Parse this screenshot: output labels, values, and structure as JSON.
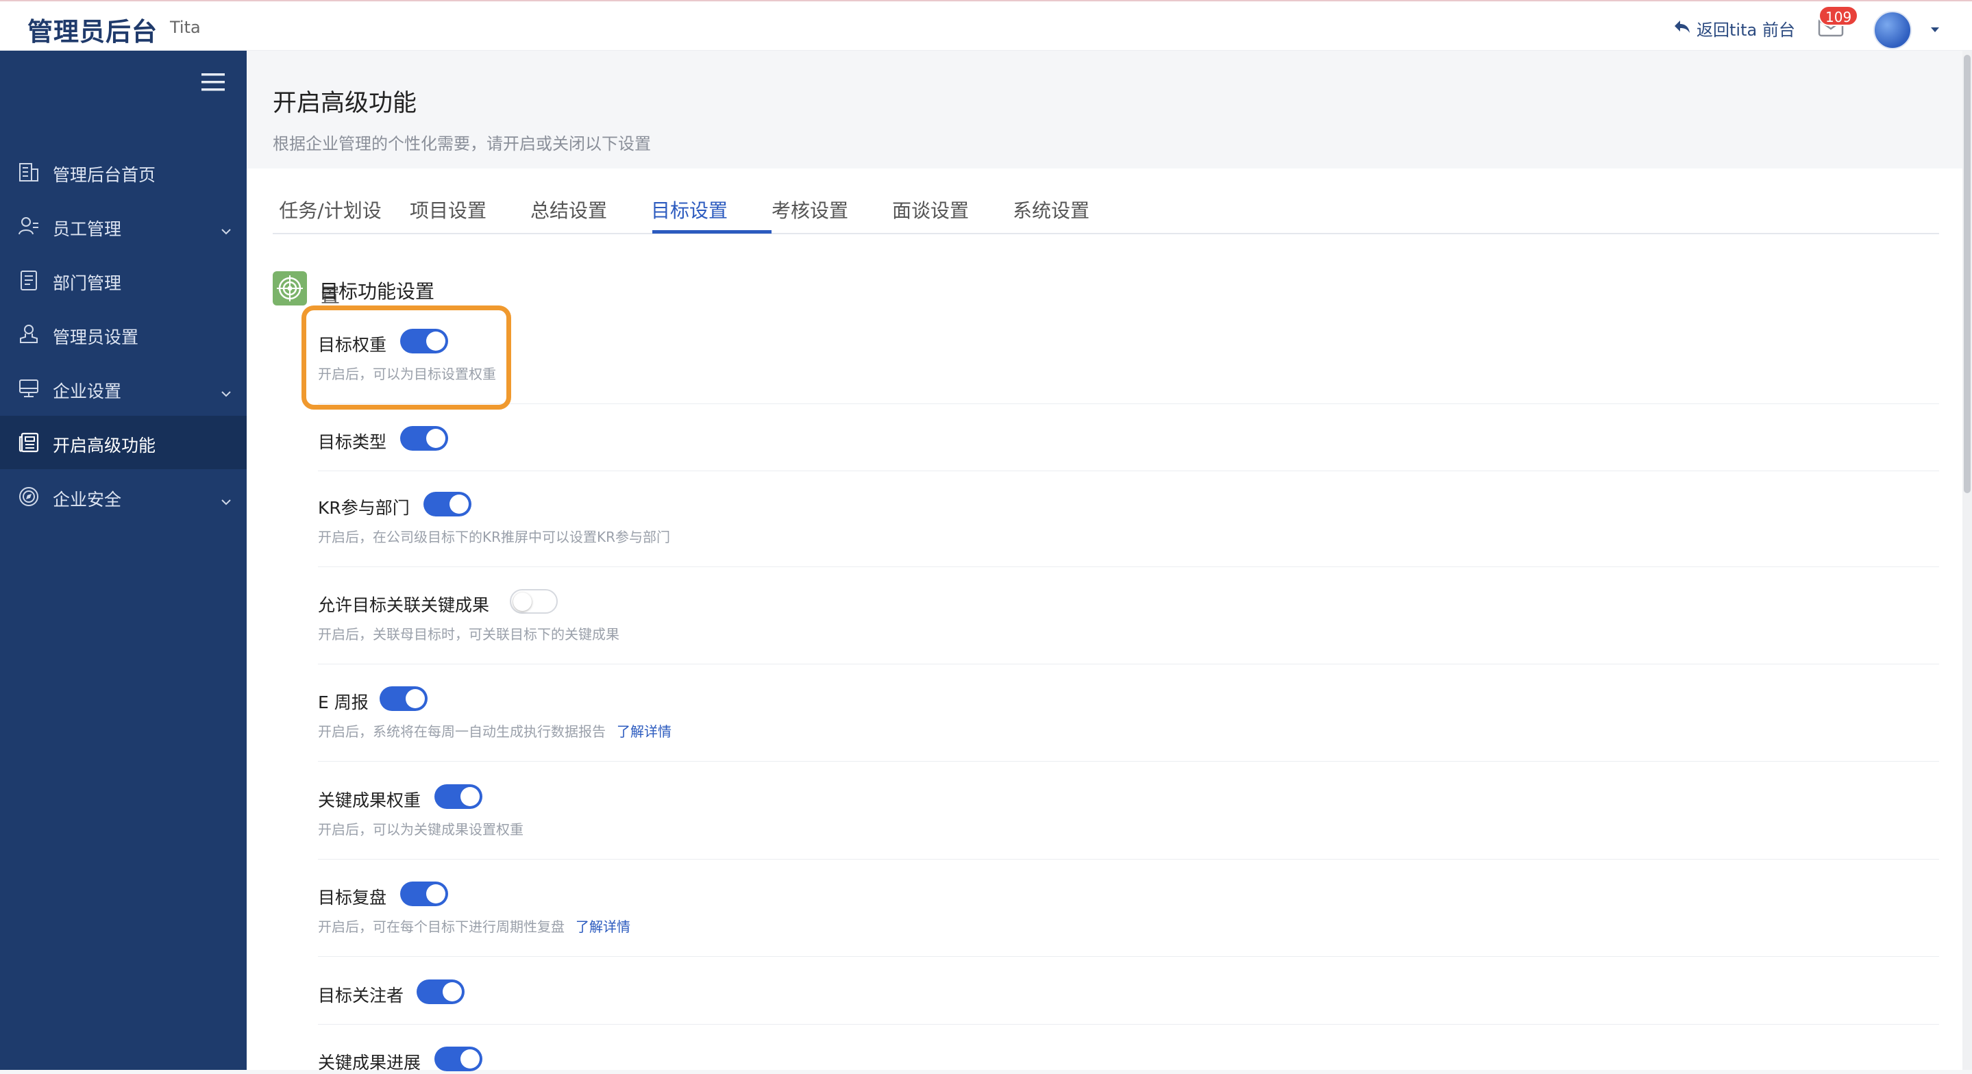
{
  "header": {
    "app_title": "管理员后台",
    "app_subtitle": "Tita",
    "back_link": "返回tita 前台",
    "notification_count": "109",
    "accent_color": "#2c5bbf",
    "badge_color": "#e8413a"
  },
  "sidebar": {
    "background": "#1e3b6c",
    "items": [
      {
        "label": "管理后台首页",
        "icon": "building-icon",
        "expandable": false,
        "active": false
      },
      {
        "label": "员工管理",
        "icon": "users-icon",
        "expandable": true,
        "active": false
      },
      {
        "label": "部门管理",
        "icon": "document-icon",
        "expandable": false,
        "active": false
      },
      {
        "label": "管理员设置",
        "icon": "admin-stamp-icon",
        "expandable": false,
        "active": false
      },
      {
        "label": "企业设置",
        "icon": "monitor-icon",
        "expandable": true,
        "active": false
      },
      {
        "label": "开启高级功能",
        "icon": "newspaper-icon",
        "expandable": false,
        "active": true
      },
      {
        "label": "企业安全",
        "icon": "compass-icon",
        "expandable": true,
        "active": false
      }
    ]
  },
  "page": {
    "title": "开启高级功能",
    "description": "根据企业管理的个性化需要，请开启或关闭以下设置"
  },
  "tabs": [
    {
      "label": "任务/计划设置",
      "active": false
    },
    {
      "label": "项目设置",
      "active": false
    },
    {
      "label": "总结设置",
      "active": false
    },
    {
      "label": "目标设置",
      "active": true
    },
    {
      "label": "考核设置",
      "active": false
    },
    {
      "label": "面谈设置",
      "active": false
    },
    {
      "label": "系统设置",
      "active": false
    }
  ],
  "section": {
    "title": "目标功能设置",
    "icon": "target-icon"
  },
  "settings": [
    {
      "name": "目标权重",
      "enabled": true,
      "description": "开启后，可以为目标设置权重",
      "link": ""
    },
    {
      "name": "目标类型",
      "enabled": true,
      "description": "",
      "link": ""
    },
    {
      "name": "KR参与部门",
      "enabled": true,
      "description": "开启后，在公司级目标下的KR推屏中可以设置KR参与部门",
      "link": ""
    },
    {
      "name": "允许目标关联关键成果",
      "enabled": false,
      "description": "开启后，关联母目标时，可关联目标下的关键成果",
      "link": ""
    },
    {
      "name": "E 周报",
      "enabled": true,
      "description": "开启后，系统将在每周一自动生成执行数据报告",
      "link": "了解详情"
    },
    {
      "name": "关键成果权重",
      "enabled": true,
      "description": "开启后，可以为关键成果设置权重",
      "link": ""
    },
    {
      "name": "目标复盘",
      "enabled": true,
      "description": "开启后，可在每个目标下进行周期性复盘",
      "link": "了解详情"
    },
    {
      "name": "目标关注者",
      "enabled": true,
      "description": "",
      "link": ""
    },
    {
      "name": "关键成果进展",
      "enabled": true,
      "description": "",
      "link": ""
    }
  ]
}
